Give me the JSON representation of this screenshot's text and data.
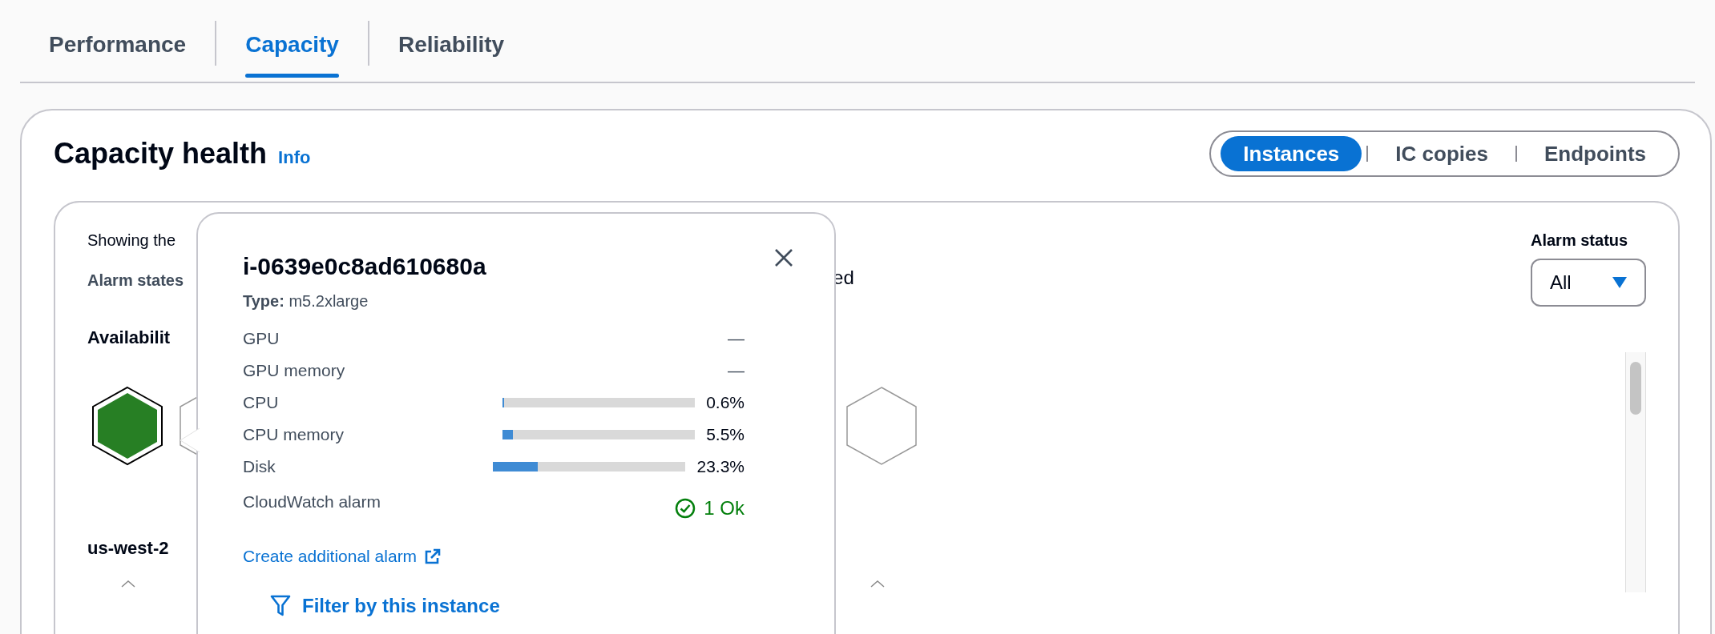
{
  "tabs": [
    {
      "label": "Performance",
      "selected": false
    },
    {
      "label": "Capacity",
      "selected": true
    },
    {
      "label": "Reliability",
      "selected": false
    }
  ],
  "panel": {
    "title": "Capacity health",
    "info_link": "Info",
    "views": [
      {
        "label": "Instances",
        "selected": true
      },
      {
        "label": "IC copies",
        "selected": false
      },
      {
        "label": "Endpoints",
        "selected": false
      }
    ],
    "description": "Showing the",
    "alarm_states_label": "Alarm states",
    "alarm_states_tail": "ed",
    "alarm_filter": {
      "label": "Alarm status",
      "value": "All"
    },
    "availability_heading": "Availabilit",
    "hexagons": [
      {
        "kind": "healthy"
      },
      {
        "kind": "empty"
      },
      {
        "kind": "empty"
      }
    ],
    "zone_label": "us-west-2"
  },
  "popover": {
    "title": "i-0639e0c8ad610680a",
    "type": "**Type:** m5.2xlarge",
    "metrics": [
      {
        "kind": "text",
        "label": "GPU",
        "value": "—"
      },
      {
        "kind": "text",
        "label": "GPU memory",
        "value": "—"
      },
      {
        "kind": "bar",
        "label": "CPU",
        "level": 0.006,
        "value": "0.6%"
      },
      {
        "kind": "bar",
        "label": "CPU memory",
        "level": 0.055,
        "value": "5.5%"
      },
      {
        "kind": "bar",
        "label": "Disk",
        "level": 0.233,
        "value": "23.3%"
      }
    ],
    "alarm": {
      "label": "CloudWatch alarm",
      "status": "1 Ok"
    },
    "create_link": "Create additional alarm",
    "filter_button": "Filter by this instance"
  }
}
